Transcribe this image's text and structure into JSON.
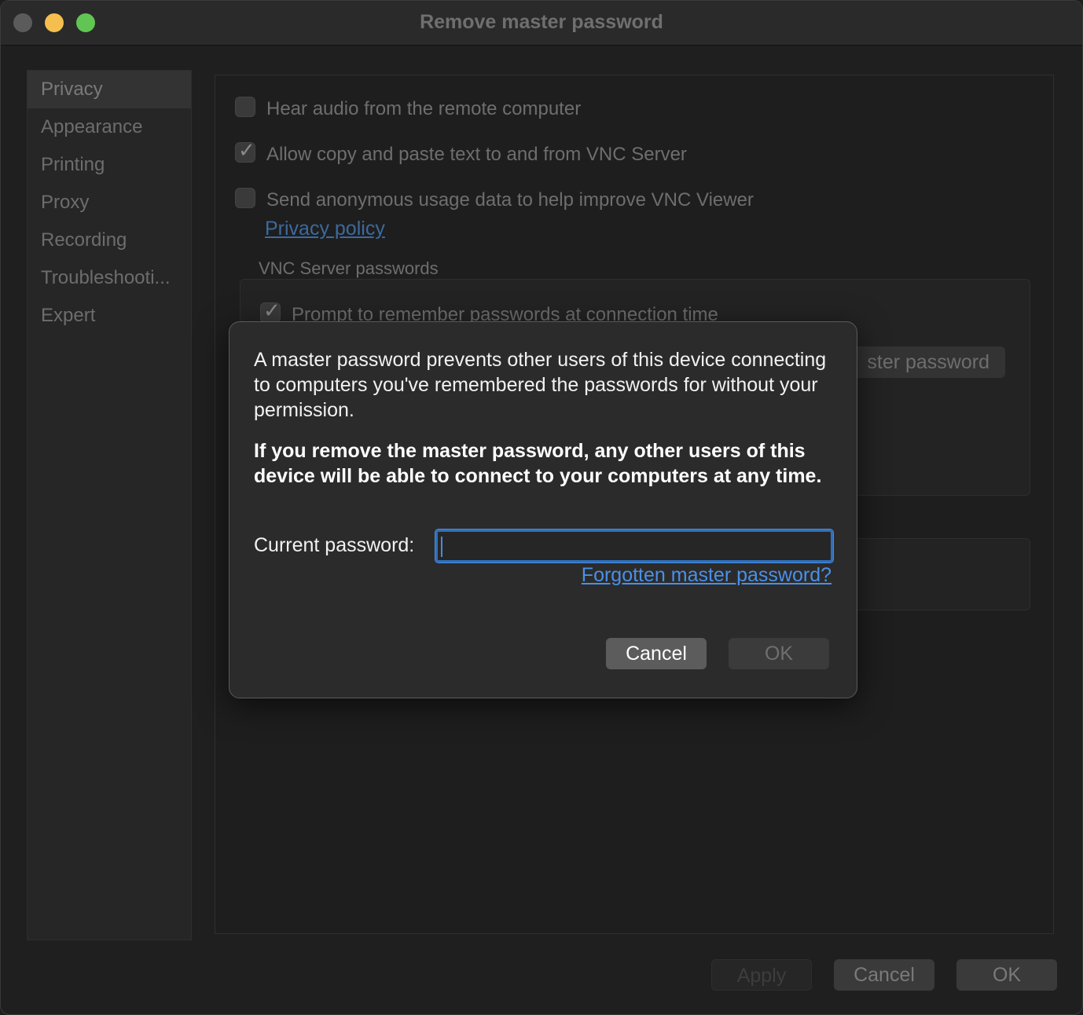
{
  "window": {
    "title": "Remove master password"
  },
  "sidebar": {
    "items": [
      {
        "label": "Privacy"
      },
      {
        "label": "Appearance"
      },
      {
        "label": "Printing"
      },
      {
        "label": "Proxy"
      },
      {
        "label": "Recording"
      },
      {
        "label": "Troubleshooti..."
      },
      {
        "label": "Expert"
      }
    ],
    "selected": "Privacy"
  },
  "privacy": {
    "hear_audio": {
      "label": "Hear audio from the remote computer",
      "checked": false
    },
    "copy_paste": {
      "label": "Allow copy and paste text to and from VNC Server",
      "checked": true
    },
    "usage_data": {
      "label": "Send anonymous usage data to help improve VNC Viewer",
      "checked": false
    },
    "privacy_link": "Privacy policy",
    "server_passwords_title": "VNC Server passwords",
    "remember_prompt": {
      "label": "Prompt to remember passwords at connection time",
      "checked": true
    },
    "master_button_partial": "ster password"
  },
  "footer": {
    "apply": "Apply",
    "cancel": "Cancel",
    "ok": "OK"
  },
  "dialog": {
    "info": "A master password prevents other users of this device connecting to computers you've remembered the passwords for without your permission.",
    "warning": "If you remove the master password, any other users of this device will be able to connect to your computers at any time.",
    "current_password_label": "Current password:",
    "current_password_value": "",
    "forgot_link": "Forgotten master password?",
    "cancel": "Cancel",
    "ok": "OK"
  },
  "icons": {
    "check": "checkmark-icon"
  },
  "colors": {
    "accent": "#2f6fbd",
    "link": "#4a90e8"
  }
}
